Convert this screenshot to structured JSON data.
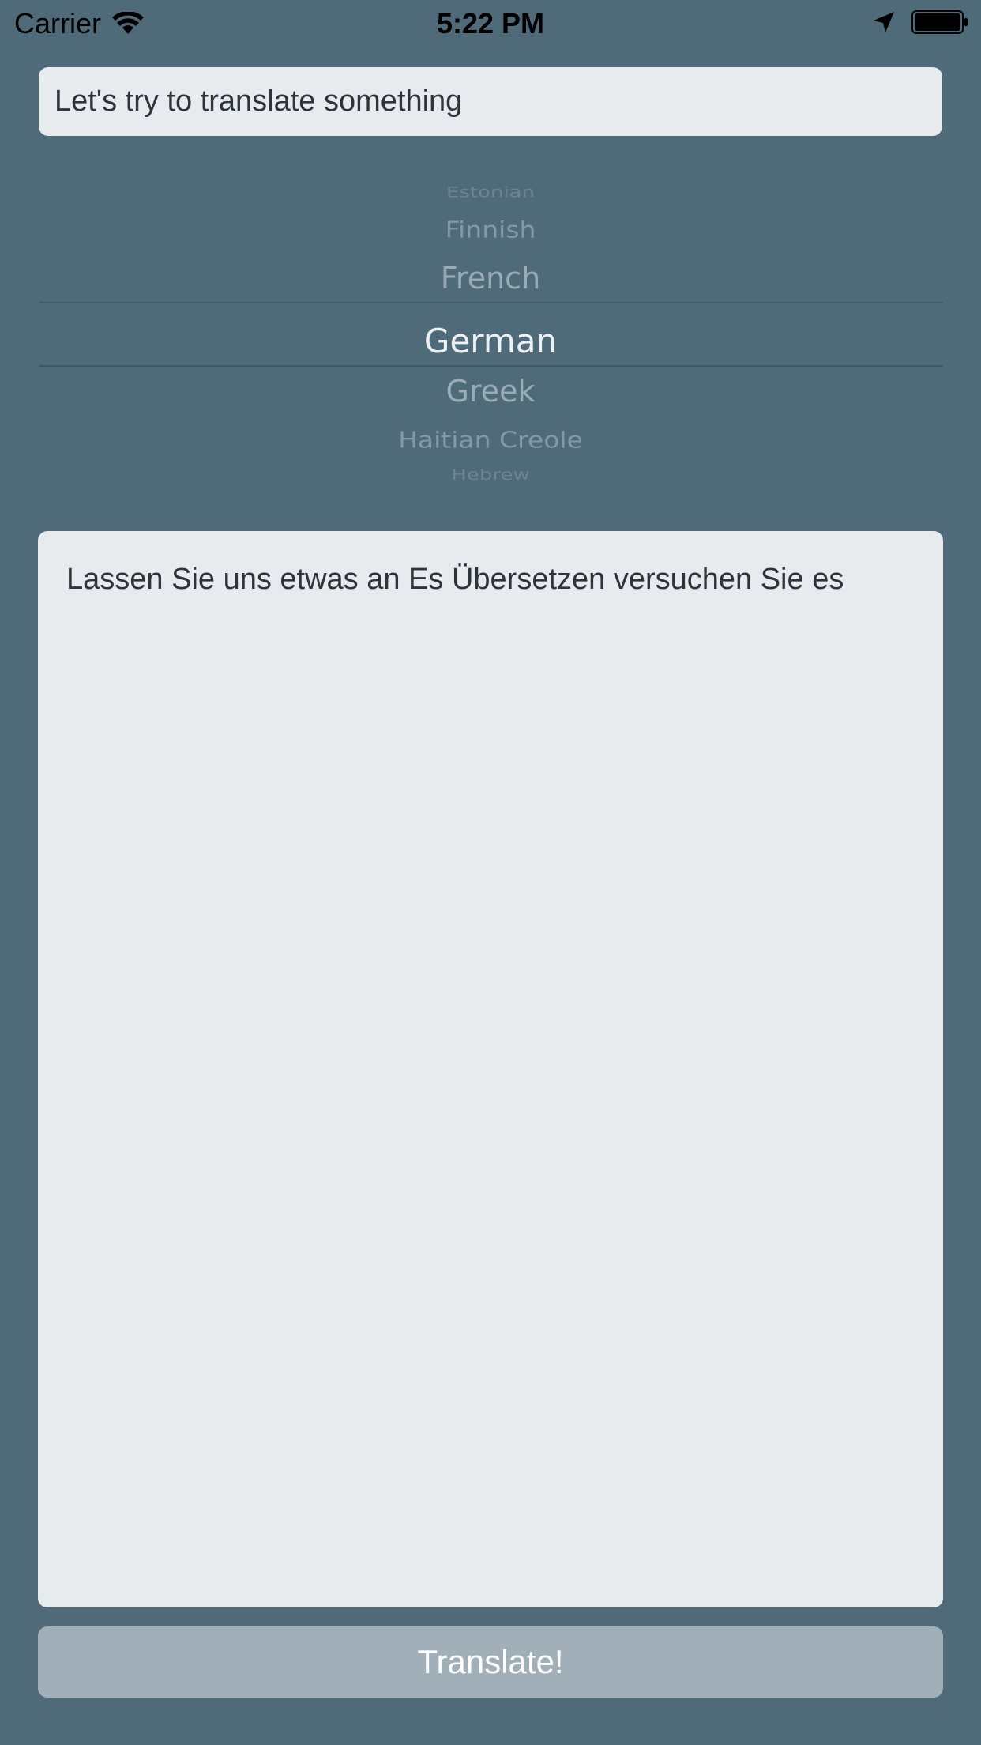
{
  "status_bar": {
    "carrier": "Carrier",
    "time": "5:22 PM",
    "icons": [
      "wifi-icon",
      "location-arrow-icon",
      "battery-icon"
    ]
  },
  "input": {
    "value": "Let's try to translate something"
  },
  "language_picker": {
    "visible_items": [
      "Estonian",
      "Finnish",
      "French",
      "German",
      "Greek",
      "Haitian Creole",
      "Hebrew"
    ],
    "selected": "German"
  },
  "output": {
    "text": "Lassen Sie uns etwas an Es Übersetzen versuchen Sie es"
  },
  "translate_button": {
    "label": "Translate!"
  },
  "colors": {
    "background": "#4f6b79",
    "field_background": "#e8ebee",
    "button_background": "#a1afb8",
    "text_dark": "#2d343a"
  }
}
